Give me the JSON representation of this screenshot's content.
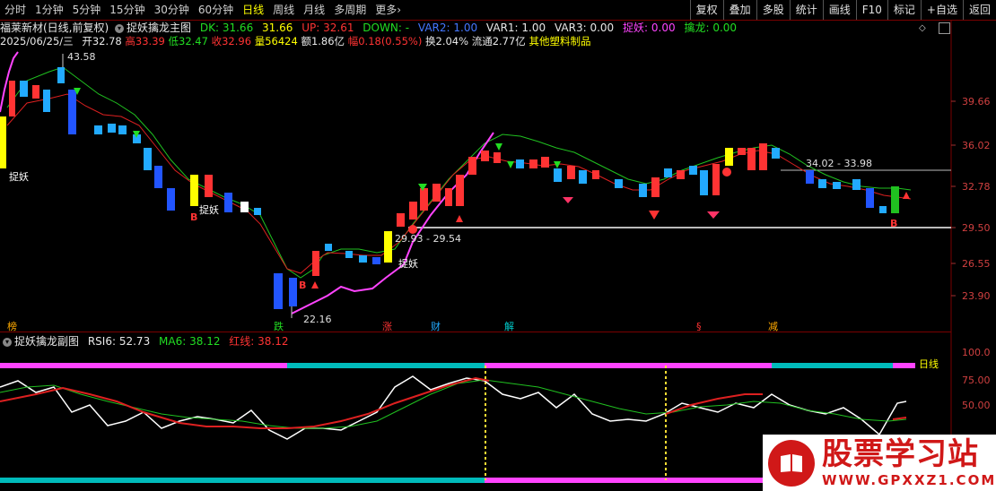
{
  "toolbar": {
    "tabs": [
      {
        "label": "分时",
        "active": false
      },
      {
        "label": "1分钟",
        "active": false
      },
      {
        "label": "5分钟",
        "active": false
      },
      {
        "label": "15分钟",
        "active": false
      },
      {
        "label": "30分钟",
        "active": false
      },
      {
        "label": "60分钟",
        "active": false
      },
      {
        "label": "日线",
        "active": true
      },
      {
        "label": "周线",
        "active": false
      },
      {
        "label": "月线",
        "active": false
      },
      {
        "label": "多周期",
        "active": false
      },
      {
        "label": "更多",
        "active": false
      }
    ],
    "more_arrow": "›",
    "tools": [
      "复权",
      "叠加",
      "多股",
      "统计",
      "画线",
      "F10",
      "标记",
      "+自选",
      "返回"
    ]
  },
  "main_header": {
    "stock": "福莱新材(日线,前复权)",
    "indicator": "捉妖擒龙主图",
    "dk_label": "DK:",
    "dk_value": "31.66",
    "v2": "31.66",
    "up_label": "UP:",
    "up_value": "32.61",
    "down_label": "DOWN:",
    "down_value": "-",
    "var2_label": "VAR2:",
    "var2_value": "1.00",
    "var1_label": "VAR1:",
    "var1_value": "1.00",
    "var3_label": "VAR3:",
    "var3_value": "0.00",
    "zhuoyao_label": "捉妖:",
    "zhuoyao_value": "0.00",
    "qinlong_label": "擒龙:",
    "qinlong_value": "0.00"
  },
  "info_line": {
    "date": "2025/06/25/三",
    "open_label": "开",
    "open": "32.78",
    "high_label": "高",
    "high": "33.39",
    "low_label": "低",
    "low": "32.47",
    "close_label": "收",
    "close": "32.96",
    "vol_label": "量",
    "vol": "56424",
    "amount_label": "额",
    "amount": "1.86亿",
    "change_label": "幅",
    "change": "0.18(0.55%)",
    "turnover_label": "换",
    "turnover": "2.04%",
    "float_label": "流通",
    "float": "2.77亿",
    "sector": "其他塑料制品"
  },
  "sub_header": {
    "indicator": "捉妖擒龙副图",
    "rsi_label": "RSI6:",
    "rsi_value": "52.73",
    "ma_label": "MA6:",
    "ma_value": "38.12",
    "red_label": "红线:",
    "red_value": "38.12"
  },
  "price_axis": {
    "labels": [
      "39.66",
      "36.02",
      "32.78",
      "29.50",
      "26.55",
      "23.90"
    ]
  },
  "sub_axis": {
    "labels": [
      "100.0",
      "75.00",
      "50.00"
    ],
    "right_tag": "日线"
  },
  "annotations": {
    "high": "43.58",
    "low": "22.16",
    "range1": "29.93 - 29.54",
    "range2": "34.02 - 33.98",
    "zhuoyao_text": "捉妖",
    "buy_mark": "B"
  },
  "event_tags": [
    "榜",
    "跌",
    "涨",
    "财",
    "解",
    "§",
    "减"
  ],
  "watermark": {
    "title": "股票学习站",
    "url": "WWW.GPXXZ1.COM"
  },
  "colors": {
    "up": "#ff3333",
    "down": "#22aaff",
    "ma_green": "#20c020",
    "ma_red": "#dd2020",
    "magenta": "#ff44ff",
    "yellow": "#ffff00",
    "cyan": "#00bbbb"
  }
}
